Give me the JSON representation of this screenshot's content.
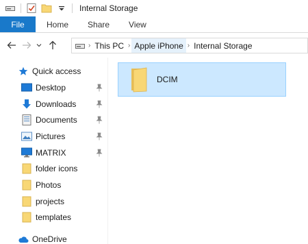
{
  "window": {
    "title": "Internal Storage"
  },
  "qat": {
    "icons": [
      "drive-icon",
      "properties-checkmark-icon",
      "new-folder-icon",
      "customize-dropdown-icon"
    ]
  },
  "ribbon": {
    "tabs": [
      {
        "label": "File",
        "active": true
      },
      {
        "label": "Home"
      },
      {
        "label": "Share"
      },
      {
        "label": "View"
      }
    ]
  },
  "address": {
    "breadcrumbs": [
      {
        "label": "This PC"
      },
      {
        "label": "Apple iPhone",
        "highlighted": true
      },
      {
        "label": "Internal Storage"
      }
    ]
  },
  "nav": {
    "quick_access": "Quick access",
    "items": [
      {
        "label": "Desktop",
        "icon": "desktop-icon",
        "pinned": true
      },
      {
        "label": "Downloads",
        "icon": "downloads-arrow-icon",
        "pinned": true
      },
      {
        "label": "Documents",
        "icon": "documents-icon",
        "pinned": true
      },
      {
        "label": "Pictures",
        "icon": "pictures-icon",
        "pinned": true
      },
      {
        "label": "MATRIX",
        "icon": "monitor-icon",
        "pinned": true
      },
      {
        "label": "folder icons",
        "icon": "folder-icon",
        "pinned": false
      },
      {
        "label": "Photos",
        "icon": "folder-icon",
        "pinned": false
      },
      {
        "label": "projects",
        "icon": "folder-icon",
        "pinned": false
      },
      {
        "label": "templates",
        "icon": "folder-icon",
        "pinned": false
      }
    ],
    "onedrive": "OneDrive"
  },
  "content": {
    "items": [
      {
        "label": "DCIM",
        "icon": "folder-icon",
        "selected": true
      }
    ]
  },
  "colors": {
    "file_tab": "#1979ca",
    "selection_fill": "#cce8ff",
    "selection_border": "#99d1ff",
    "folder_yellow": "#f8d775",
    "accent_blue": "#1e7ad6"
  }
}
